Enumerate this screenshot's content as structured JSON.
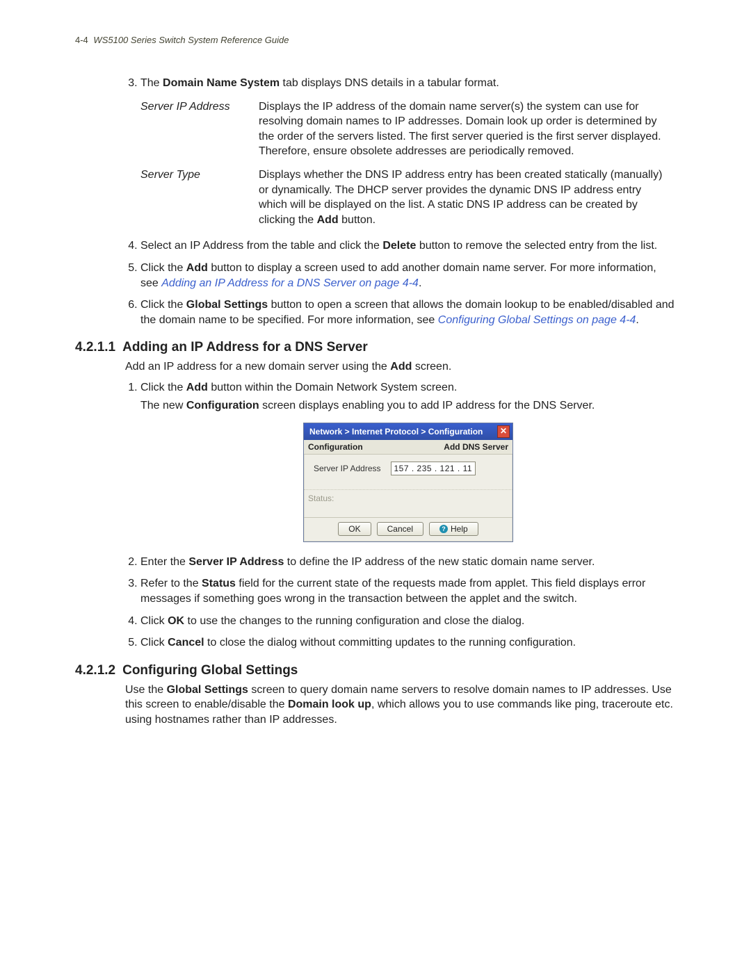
{
  "header": {
    "page_num": "4-4",
    "doc_title": "WS5100 Series Switch System Reference Guide"
  },
  "step3": {
    "num": "3.",
    "pre": "The ",
    "bold": "Domain Name System",
    "post": " tab displays DNS details in a tabular format."
  },
  "defs": [
    {
      "term": "Server IP Address",
      "desc": "Displays the IP address of the domain name server(s) the system can use for resolving domain names to IP addresses. Domain look up order is determined by the order of the servers listed. The first server queried is the first server displayed. Therefore, ensure obsolete addresses are periodically removed."
    },
    {
      "term": "Server Type",
      "desc_pre": "Displays whether the DNS IP address entry has been created statically (manually) or dynamically. The DHCP server provides the dynamic DNS IP address entry which will be displayed on the list. A static DNS IP address can be created by clicking the ",
      "desc_bold": "Add",
      "desc_post": " button."
    }
  ],
  "step4": {
    "num": "4.",
    "pre": "Select an IP Address from the table and click the ",
    "bold": "Delete",
    "post": " button to remove the selected entry from the list."
  },
  "step5": {
    "num": "5.",
    "pre": "Click the ",
    "bold": "Add",
    "post": " button to display a screen used to add another domain name server. For more information, see ",
    "xref": "Adding an IP Address for a DNS Server on page 4-4",
    "tail": "."
  },
  "step6": {
    "num": "6.",
    "pre": "Click the ",
    "bold": "Global Settings",
    "post": " button to open a screen that allows the domain lookup to be enabled/disabled and the domain name to be specified. For more information, see ",
    "xref": "Configuring Global Settings on page 4-4",
    "tail": "."
  },
  "sec1": {
    "num": "4.2.1.1",
    "title": "Adding an IP Address for a DNS Server",
    "intro_pre": "Add an IP address for a new domain server using the ",
    "intro_bold": "Add",
    "intro_post": " screen.",
    "s1": {
      "num": "1.",
      "pre": "Click the ",
      "bold": "Add",
      "post": " button within the Domain Network System screen."
    },
    "s1b_pre": "The new ",
    "s1b_bold": "Configuration",
    "s1b_post": " screen displays enabling you to add IP address for the DNS Server.",
    "s2": {
      "num": "2.",
      "pre": "Enter the ",
      "bold": "Server IP Address",
      "post": " to define the IP address of the new static domain name server."
    },
    "s3": {
      "num": "3.",
      "pre": "Refer to the ",
      "bold": "Status",
      "post": " field for the current state of the requests made from applet. This field displays error messages if something goes wrong in the transaction between the applet and the switch."
    },
    "s4": {
      "num": "4.",
      "pre": "Click ",
      "bold": "OK",
      "post": " to use the changes to the running configuration and close the dialog."
    },
    "s5": {
      "num": "5.",
      "pre": "Click ",
      "bold": "Cancel",
      "post": " to close the dialog without committing updates to the running configuration."
    }
  },
  "dialog": {
    "breadcrumb": "Network > Internet Protocol > Configuration",
    "sub_left": "Configuration",
    "sub_right": "Add DNS Server",
    "field_label": "Server IP Address",
    "ip_value": "157 . 235 . 121 .  11",
    "status_label": "Status:",
    "ok": "OK",
    "cancel": "Cancel",
    "help": "Help",
    "close_glyph": "✕"
  },
  "sec2": {
    "num": "4.2.1.2",
    "title": "Configuring Global Settings",
    "p_pre": "Use the ",
    "p_b1": "Global Settings",
    "p_mid": " screen to query domain name servers to resolve domain names to IP addresses. Use this screen to enable/disable the ",
    "p_b2": "Domain look up",
    "p_post": ", which allows you to use commands like ping, traceroute etc. using hostnames rather than IP addresses."
  }
}
